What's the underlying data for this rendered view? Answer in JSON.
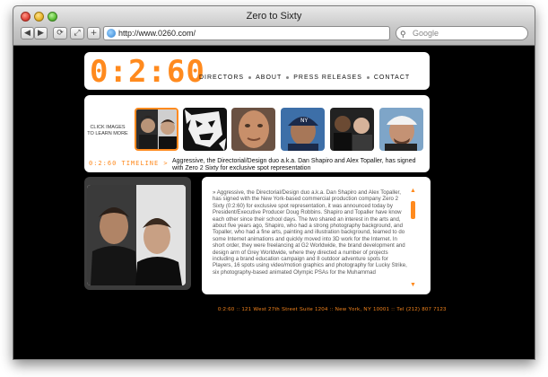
{
  "window": {
    "title": "Zero to Sixty"
  },
  "toolbar": {
    "back_label": "◀",
    "forward_label": "▶",
    "reload_label": "⟳",
    "snapback_label": "⤢",
    "add_bookmark_label": "+",
    "url": "http://www.0260.com/",
    "search_placeholder": "Google"
  },
  "brand": {
    "logo_text": "0:2:60",
    "accent_color": "#ff8a1e"
  },
  "nav": {
    "items": [
      "DIRECTORS",
      "ABOUT",
      "PRESS RELEASES",
      "CONTACT"
    ]
  },
  "gallery": {
    "instructions": "CLICK IMAGES TO LEARN MORE",
    "thumbnails": [
      {
        "name": "duo-portrait",
        "selected": true
      },
      {
        "name": "graphic-face",
        "selected": false
      },
      {
        "name": "man-closeup",
        "selected": false
      },
      {
        "name": "ny-cap-man",
        "selected": false
      },
      {
        "name": "two-men",
        "selected": false
      },
      {
        "name": "white-cap-man",
        "selected": false
      }
    ]
  },
  "timeline": {
    "label": "0:2:60 TIMELINE >",
    "headline": "Aggressive, the Directorial/Design duo a.k.a. Dan Shapiro and Alex Topaller, has signed with Zero 2 Sixty for exclusive spot representation"
  },
  "article": {
    "body": "» Aggressive, the Directorial/Design duo a.k.a. Dan Shapiro and Alex Topaller, has signed with the New York-based commercial production company Zero 2 Sixty (0:2:60) for exclusive spot representation, it was announced today by President/Executive Producer Doug Robbins. Shapiro and Topaller have know each other since their school days. The two shared an interest in the arts and, about five years ago, Shapiro, who had a strong photography background, and Topaller, who had a fine arts, painting and illustration background, teamed to do some Internet animations and quickly moved into 3D work for the Internet. In short order, they were freelancing at G2 Worldwide, the brand development and design arm of Grey Worldwide, where they directed a number of projects including a brand education campaign and 8 outdoor adventure spots for Players, 16 spots using video/motion graphics and photography for Lucky Strike, six photography-based animated Olympic PSAs for the Muhammad",
    "scroll_up": "▲",
    "scroll_down": "▼"
  },
  "footer": {
    "text": "0:2:60 :: 121 West 27th Street Suite 1204 :: New York, NY 10001 :: Tel (212) 807 7123"
  }
}
